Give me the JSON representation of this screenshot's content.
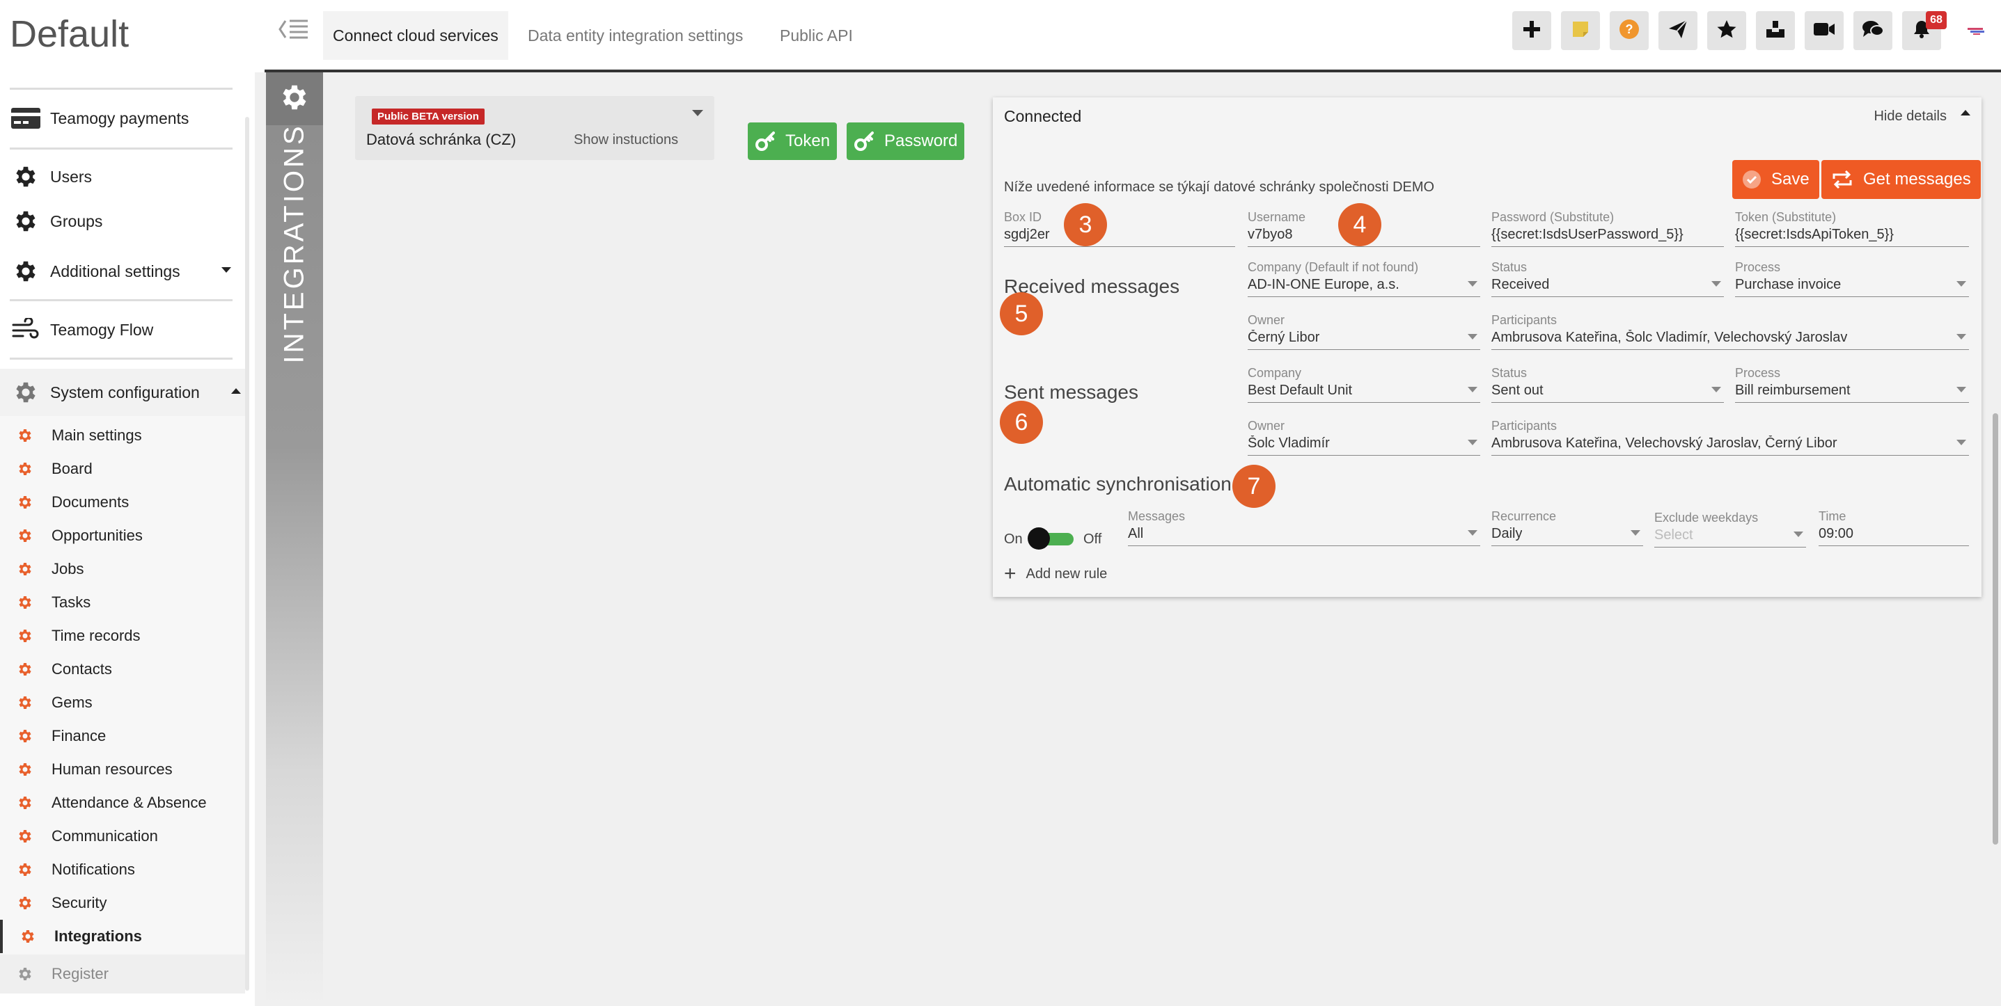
{
  "app": {
    "title": "Default"
  },
  "sidebar": {
    "items": [
      {
        "label": "Teamogy payments",
        "icon": "credit-card-icon"
      },
      {
        "label": "Users",
        "icon": "gear-icon"
      },
      {
        "label": "Groups",
        "icon": "gear-icon"
      },
      {
        "label": "Additional settings",
        "icon": "gear-icon"
      },
      {
        "label": "Teamogy Flow",
        "icon": "wind-icon"
      },
      {
        "label": "System configuration",
        "icon": "gear-icon"
      }
    ],
    "subitems": [
      {
        "label": "Main settings"
      },
      {
        "label": "Board"
      },
      {
        "label": "Documents"
      },
      {
        "label": "Opportunities"
      },
      {
        "label": "Jobs"
      },
      {
        "label": "Tasks"
      },
      {
        "label": "Time records"
      },
      {
        "label": "Contacts"
      },
      {
        "label": "Gems"
      },
      {
        "label": "Finance"
      },
      {
        "label": "Human resources"
      },
      {
        "label": "Attendance & Absence"
      },
      {
        "label": "Communication"
      },
      {
        "label": "Notifications"
      },
      {
        "label": "Security"
      },
      {
        "label": "Integrations"
      },
      {
        "label": "Register"
      }
    ]
  },
  "topbar": {
    "tabs": [
      {
        "label": "Connect cloud services"
      },
      {
        "label": "Data entity integration settings"
      },
      {
        "label": "Public API"
      }
    ],
    "notification_count": "68",
    "buttons": [
      "plus-icon",
      "sticky-note-icon",
      "help-icon",
      "send-icon",
      "star-icon",
      "inbox-icon",
      "video-icon",
      "chat-icon",
      "bell-icon",
      "user-avatar"
    ]
  },
  "side_strip": {
    "label": "INTEGRATIONS"
  },
  "integration_card": {
    "badge": "Public BETA version",
    "name": "Datová schránka (CZ)",
    "show_instructions": "Show instuctions",
    "token_button": "Token",
    "password_button": "Password"
  },
  "details": {
    "status": "Connected",
    "hide_details": "Hide details",
    "info": "Níže uvedené informace se týkají datové schránky společnosti DEMO",
    "save_button": "Save",
    "get_messages_button": "Get messages",
    "credentials": {
      "box_id_label": "Box ID",
      "box_id": "sgdj2er",
      "username_label": "Username",
      "username": "v7byo8",
      "password_label": "Password (Substitute)",
      "password": "{{secret:IsdsUserPassword_5}}",
      "token_label": "Token (Substitute)",
      "token": "{{secret:IsdsApiToken_5}}"
    },
    "received": {
      "title": "Received messages",
      "company_label": "Company (Default if not found)",
      "company": "AD-IN-ONE Europe, a.s.",
      "status_label": "Status",
      "status": "Received",
      "process_label": "Process",
      "process": "Purchase invoice",
      "owner_label": "Owner",
      "owner": "Černý Libor",
      "participants_label": "Participants",
      "participants": "Ambrusova Kateřina,  Šolc Vladimír,  Velechovský Jaroslav"
    },
    "sent": {
      "title": "Sent messages",
      "company_label": "Company",
      "company": "Best Default Unit",
      "status_label": "Status",
      "status": "Sent out",
      "process_label": "Process",
      "process": "Bill reimbursement",
      "owner_label": "Owner",
      "owner": "Šolc Vladimír",
      "participants_label": "Participants",
      "participants": "Ambrusova Kateřina,  Velechovský Jaroslav,  Černý Libor"
    },
    "sync": {
      "title": "Automatic synchronisation",
      "on_label": "On",
      "off_label": "Off",
      "messages_label": "Messages",
      "messages": "All",
      "recurrence_label": "Recurrence",
      "recurrence": "Daily",
      "exclude_label": "Exclude weekdays",
      "exclude_placeholder": "Select",
      "time_label": "Time",
      "time": "09:00",
      "add_rule": "Add new rule"
    },
    "markers": [
      "3",
      "4",
      "5",
      "6",
      "7"
    ]
  }
}
